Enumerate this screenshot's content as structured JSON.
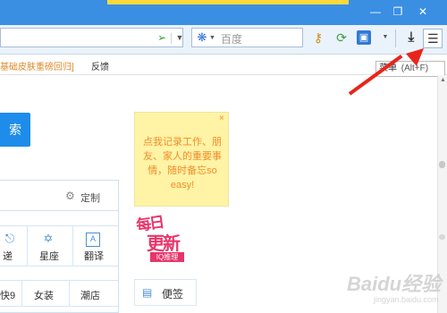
{
  "toolbar": {
    "search_placeholder": "百度"
  },
  "bookmarks": {
    "first_text": "基础皮肤重磅回归]",
    "feedback": "反馈"
  },
  "menu_hint": {
    "label": "菜单",
    "shortcut": "(Alt+F)"
  },
  "main": {
    "search_button": "索",
    "customize": "定制",
    "grid_row1": [
      "递",
      "星座",
      "翻译"
    ],
    "grid_row2": [
      "快9",
      "女装",
      "潮店"
    ]
  },
  "note": {
    "text": "点我记录工作、朋友、家人的重要事情，随时备忘so easy!"
  },
  "logo": {
    "line1": "每日",
    "line2": "更新",
    "tag": "IQ推理"
  },
  "sticky": {
    "label": "便签"
  },
  "watermark": {
    "text": "Baidu经验",
    "url": "jingyan.baidu.com"
  },
  "colors": {
    "accent": "#1e8ceb",
    "arrow": "#e8251a",
    "note_bg": "#fff3a6",
    "note_text": "#ef8e2a"
  }
}
